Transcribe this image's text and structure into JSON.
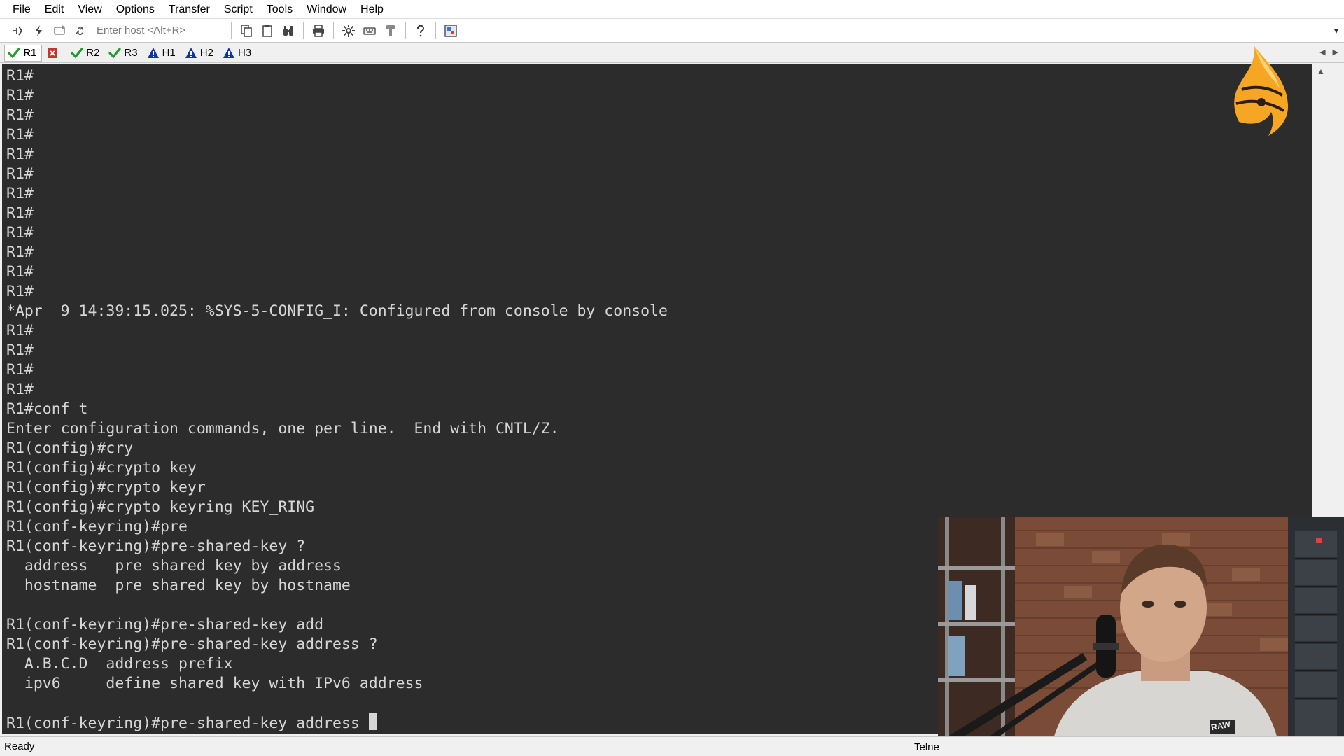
{
  "menu": [
    "File",
    "Edit",
    "View",
    "Options",
    "Transfer",
    "Script",
    "Tools",
    "Window",
    "Help"
  ],
  "toolbar": {
    "host_placeholder": "Enter host <Alt+R>",
    "icons": [
      "connect-icon",
      "quick-connect-icon",
      "reconnect-icon",
      "disconnect-icon",
      "copy-icon",
      "paste-icon",
      "find-icon",
      "print-icon",
      "settings-icon",
      "keymap-icon",
      "sftp-icon",
      "help-icon",
      "screen-icon"
    ]
  },
  "tabs": [
    {
      "label": "R1",
      "status": "connected",
      "active": true
    },
    {
      "label": "",
      "status": "close",
      "active": false
    },
    {
      "label": "R2",
      "status": "connected",
      "active": false
    },
    {
      "label": "R3",
      "status": "connected",
      "active": false
    },
    {
      "label": "H1",
      "status": "warning",
      "active": false
    },
    {
      "label": "H2",
      "status": "warning",
      "active": false
    },
    {
      "label": "H3",
      "status": "warning",
      "active": false
    }
  ],
  "terminal": {
    "lines": [
      "R1#",
      "R1#",
      "R1#",
      "R1#",
      "R1#",
      "R1#",
      "R1#",
      "R1#",
      "R1#",
      "R1#",
      "R1#",
      "R1#",
      "*Apr  9 14:39:15.025: %SYS-5-CONFIG_I: Configured from console by console",
      "R1#",
      "R1#",
      "R1#",
      "R1#",
      "R1#conf t",
      "Enter configuration commands, one per line.  End with CNTL/Z.",
      "R1(config)#cry",
      "R1(config)#crypto key",
      "R1(config)#crypto keyr",
      "R1(config)#crypto keyring KEY_RING",
      "R1(conf-keyring)#pre",
      "R1(conf-keyring)#pre-shared-key ?",
      "  address   pre shared key by address",
      "  hostname  pre shared key by hostname",
      "",
      "R1(conf-keyring)#pre-shared-key add",
      "R1(conf-keyring)#pre-shared-key address ?",
      "  A.B.C.D  address prefix",
      "  ipv6     define shared key with IPv6 address",
      ""
    ],
    "prompt_line": "R1(conf-keyring)#pre-shared-key address "
  },
  "status": {
    "left": "Ready",
    "right": "Telne"
  },
  "webcam": {
    "badge": "RAW"
  },
  "colors": {
    "terminal_bg": "#2c2c2c",
    "terminal_fg": "#d6d6d6",
    "ok_green": "#1f9d2a",
    "warn_blue": "#1034a6",
    "close_red": "#c8342c",
    "logo_orange": "#f5a623"
  }
}
